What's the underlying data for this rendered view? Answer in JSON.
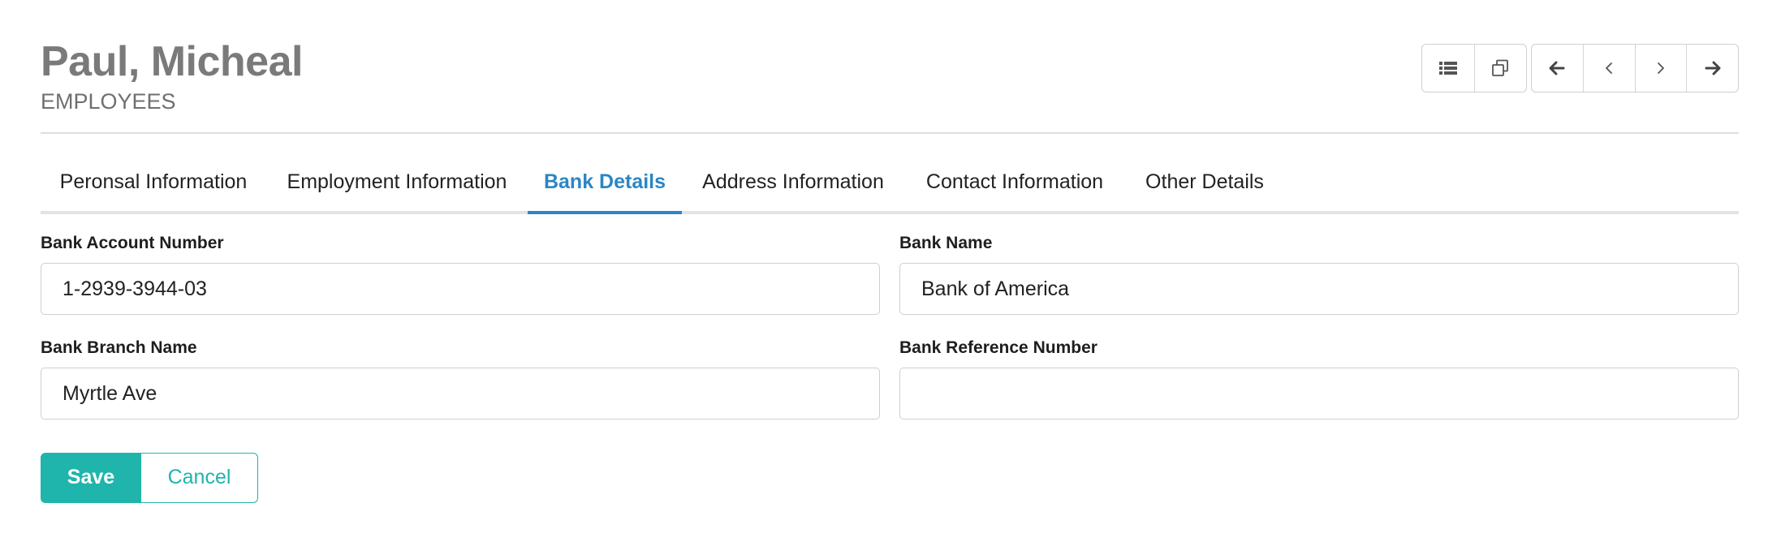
{
  "header": {
    "title": "Paul, Micheal",
    "subtitle": "EMPLOYEES"
  },
  "toolbar": {
    "buttons": [
      {
        "icon": "list-icon"
      },
      {
        "icon": "copy-icon"
      },
      {
        "icon": "arrow-left-icon"
      },
      {
        "icon": "chevron-left-icon"
      },
      {
        "icon": "chevron-right-icon"
      },
      {
        "icon": "arrow-right-icon"
      }
    ]
  },
  "tabs": [
    {
      "label": "Peronsal Information",
      "active": false
    },
    {
      "label": "Employment Information",
      "active": false
    },
    {
      "label": "Bank Details",
      "active": true
    },
    {
      "label": "Address Information",
      "active": false
    },
    {
      "label": "Contact Information",
      "active": false
    },
    {
      "label": "Other Details",
      "active": false
    }
  ],
  "form": {
    "bank_account_number": {
      "label": "Bank Account Number",
      "value": "1-2939-3944-03"
    },
    "bank_name": {
      "label": "Bank Name",
      "value": "Bank of America"
    },
    "bank_branch_name": {
      "label": "Bank Branch Name",
      "value": "Myrtle Ave"
    },
    "bank_reference_number": {
      "label": "Bank Reference Number",
      "value": ""
    }
  },
  "actions": {
    "save_label": "Save",
    "cancel_label": "Cancel"
  },
  "colors": {
    "accent_tab": "#2b86c5",
    "primary_button": "#1fb5ac",
    "title_gray": "#7a7a7a"
  }
}
